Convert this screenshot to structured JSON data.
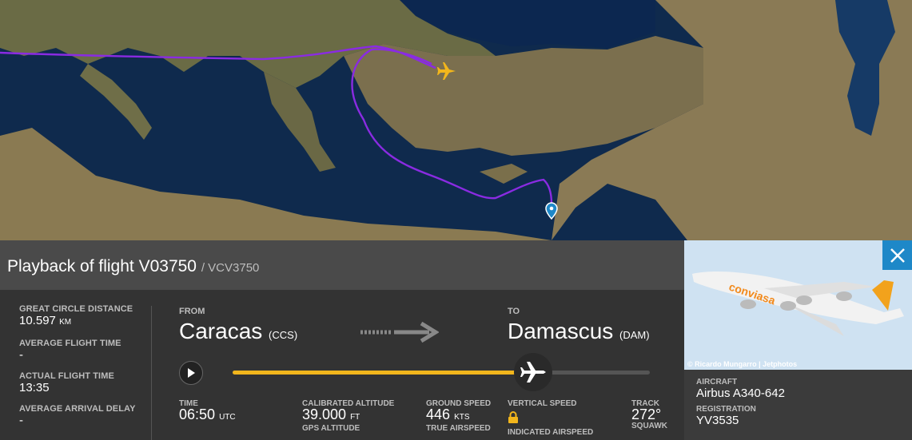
{
  "flight": {
    "title": "Playback of flight V03750",
    "callsign": "/ VCV3750"
  },
  "stats": {
    "gc_label": "GREAT CIRCLE DISTANCE",
    "gc_value": "10.597",
    "gc_unit": "KM",
    "aft_label": "AVERAGE FLIGHT TIME",
    "aft_value": "-",
    "act_label": "ACTUAL FLIGHT TIME",
    "act_value": "13:35",
    "delay_label": "AVERAGE ARRIVAL DELAY",
    "delay_value": "-"
  },
  "route": {
    "from_label": "FROM",
    "from_city": "Caracas",
    "from_code": "(CCS)",
    "to_label": "TO",
    "to_city": "Damascus",
    "to_code": "(DAM)"
  },
  "playback": {
    "progress": 0.72
  },
  "metrics": {
    "time_label": "TIME",
    "time_value": "06:50",
    "time_unit": "UTC",
    "calt_label": "CALIBRATED ALTITUDE",
    "calt_value": "39.000",
    "calt_unit": "FT",
    "gps_label": "GPS ALTITUDE",
    "gs_label": "GROUND SPEED",
    "gs_value": "446",
    "gs_unit": "KTS",
    "tas_label": "TRUE AIRSPEED",
    "vs_label": "VERTICAL SPEED",
    "ias_label": "INDICATED AIRSPEED",
    "track_label": "TRACK",
    "track_value": "272°",
    "squawk_label": "SQUAWK"
  },
  "aircraft": {
    "photo_credit": "© Ricardo Mungarro | Jetphotos",
    "livery_text": "conviasa",
    "aircraft_label": "AIRCRAFT",
    "aircraft_value": "Airbus A340-642",
    "reg_label": "REGISTRATION",
    "reg_value": "YV3535"
  },
  "colors": {
    "route": "#8a2be2",
    "accent": "#f2b61c",
    "close": "#1e88c8"
  }
}
